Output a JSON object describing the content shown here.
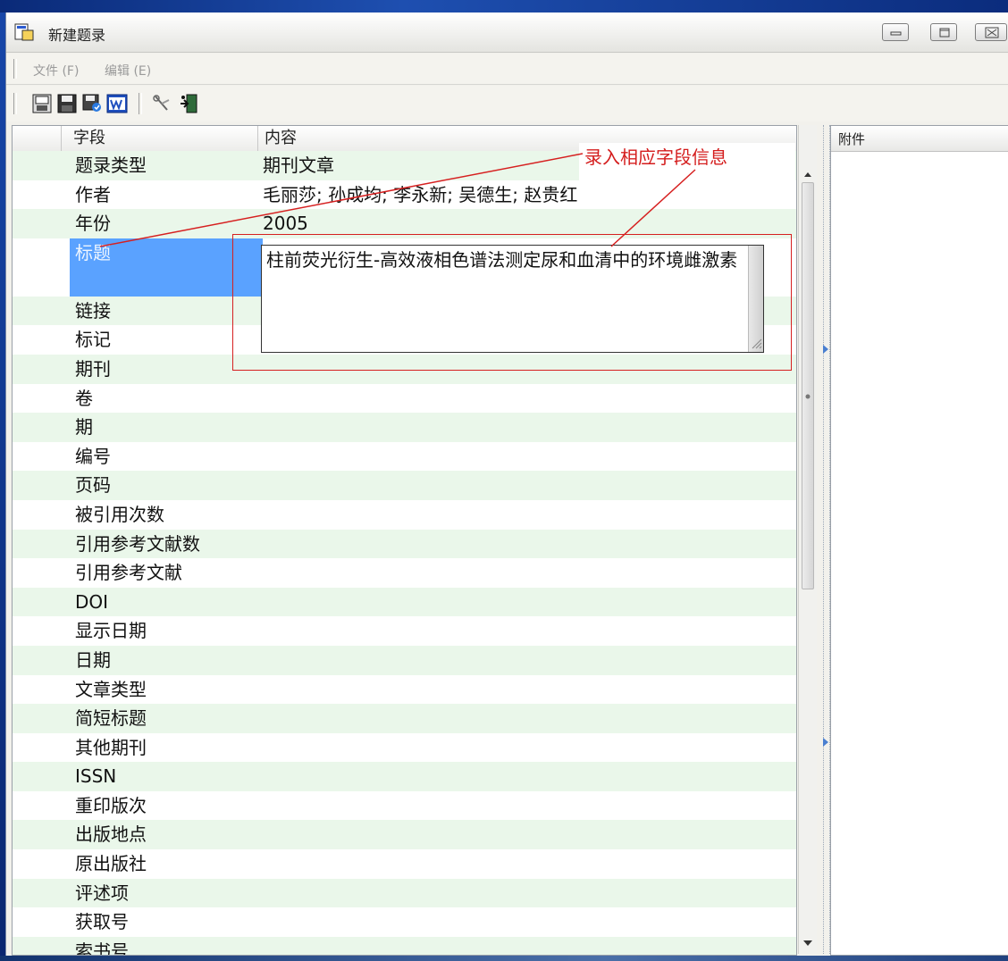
{
  "window": {
    "title": "新建题录"
  },
  "menu": {
    "items": [
      "文件 (F)",
      "编辑 (E)"
    ]
  },
  "toolbar": {
    "icons": [
      "save-record-icon",
      "save-icon",
      "save-as-icon",
      "word-icon",
      "tools-icon",
      "exit-icon"
    ]
  },
  "grid": {
    "headers": {
      "field": "字段",
      "content": "内容"
    },
    "rows": [
      {
        "field": "题录类型",
        "value": "期刊文章"
      },
      {
        "field": "作者",
        "value": "毛丽莎; 孙成均; 李永新; 吴德生; 赵贵红"
      },
      {
        "field": "年份",
        "value": "2005"
      },
      {
        "field": "标题",
        "value": "",
        "selected": true
      },
      {
        "field": "链接",
        "value": ""
      },
      {
        "field": "标记",
        "value": ""
      },
      {
        "field": "期刊",
        "value": ""
      },
      {
        "field": "卷",
        "value": ""
      },
      {
        "field": "期",
        "value": ""
      },
      {
        "field": "编号",
        "value": ""
      },
      {
        "field": "页码",
        "value": ""
      },
      {
        "field": "被引用次数",
        "value": ""
      },
      {
        "field": "引用参考文献数",
        "value": ""
      },
      {
        "field": "引用参考文献",
        "value": ""
      },
      {
        "field": "DOI",
        "value": ""
      },
      {
        "field": "显示日期",
        "value": ""
      },
      {
        "field": "日期",
        "value": ""
      },
      {
        "field": "文章类型",
        "value": ""
      },
      {
        "field": "简短标题",
        "value": ""
      },
      {
        "field": "其他期刊",
        "value": ""
      },
      {
        "field": "ISSN",
        "value": ""
      },
      {
        "field": "重印版次",
        "value": ""
      },
      {
        "field": "出版地点",
        "value": ""
      },
      {
        "field": "原出版社",
        "value": ""
      },
      {
        "field": "评述项",
        "value": ""
      },
      {
        "field": "获取号",
        "value": ""
      },
      {
        "field": "索书号",
        "value": ""
      }
    ]
  },
  "title_editor": {
    "value": "柱前荧光衍生-高效液相色谱法测定尿和血清中的环境雌激素"
  },
  "attachments": {
    "header": "附件"
  },
  "annotation": {
    "text": "录入相应字段信息",
    "color": "#d41c1c"
  },
  "colors": {
    "row_alt": "#eaf7ea",
    "selected_row": "#5aa2ff"
  }
}
